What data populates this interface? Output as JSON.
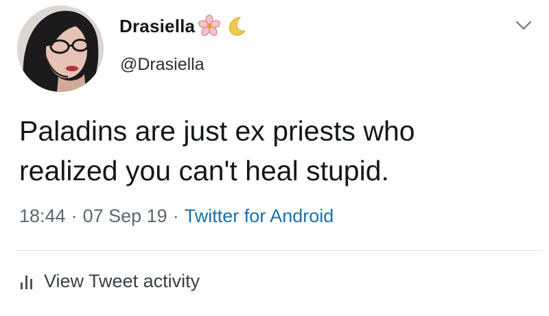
{
  "tweet": {
    "display_name": "Drasiella",
    "name_emojis": [
      "flower-icon",
      "crescent-moon-icon"
    ],
    "handle": "@Drasiella",
    "text": "Paladins are just ex priests who\nrealized you can't heal stupid.",
    "time": "18:44",
    "date": "07 Sep 19",
    "source": "Twitter for Android",
    "separator": "·",
    "activity_label": "View Tweet activity"
  },
  "colors": {
    "text": "#14171a",
    "secondary": "#5b6770",
    "link": "#1b6fb0",
    "divider": "#e6ecf0",
    "flower": "#e7a0a8",
    "moon": "#f2c84b"
  }
}
